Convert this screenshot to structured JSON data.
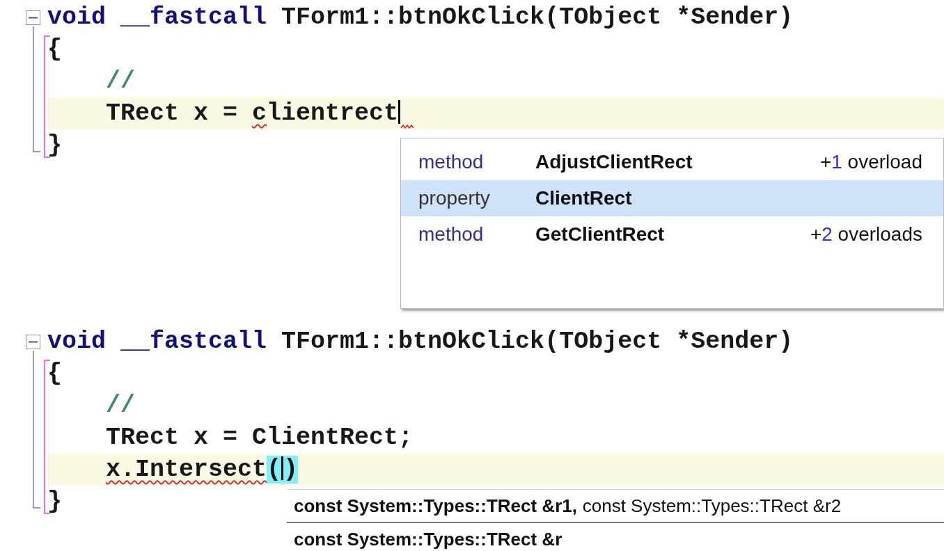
{
  "editors": [
    {
      "expanded": true,
      "lines": [
        {
          "current": false,
          "indented": false,
          "tokens": [
            {
              "text": "void __fastcall",
              "kind": "keyword"
            },
            {
              "text": " TForm1::btnOkClick(TObject *Sender)",
              "kind": "plain"
            }
          ]
        },
        {
          "current": false,
          "indented": false,
          "tokens": [
            {
              "text": "{",
              "kind": "plain"
            }
          ]
        },
        {
          "current": false,
          "indented": true,
          "tokens": [
            {
              "text": "//",
              "kind": "comment"
            }
          ]
        },
        {
          "current": true,
          "indented": true,
          "tokens": [
            {
              "text": "TRect x = ",
              "kind": "plain"
            },
            {
              "text": "c",
              "kind": "plain",
              "error": true
            },
            {
              "text": "lientrect",
              "kind": "plain",
              "caret": true,
              "error_after": true
            }
          ]
        },
        {
          "current": false,
          "indented": false,
          "tokens": [
            {
              "text": "}",
              "kind": "plain"
            }
          ]
        }
      ],
      "completion": {
        "items": [
          {
            "kind": "method",
            "label": "method",
            "name": "AdjustClientRect",
            "selected": false,
            "overloads": {
              "prefix": "+",
              "count": "1",
              "label": "overload"
            }
          },
          {
            "kind": "property",
            "label": "property",
            "name": "ClientRect",
            "selected": true
          },
          {
            "kind": "method",
            "label": "method",
            "name": "GetClientRect",
            "selected": false,
            "overloads": {
              "prefix": "+",
              "count": "2",
              "label": "overloads"
            }
          }
        ]
      }
    },
    {
      "expanded": true,
      "lines": [
        {
          "current": false,
          "indented": false,
          "tokens": [
            {
              "text": "void __fastcall",
              "kind": "keyword"
            },
            {
              "text": " TForm1::btnOkClick(TObject *Sender)",
              "kind": "plain"
            }
          ]
        },
        {
          "current": false,
          "indented": false,
          "tokens": [
            {
              "text": "{",
              "kind": "plain"
            }
          ]
        },
        {
          "current": false,
          "indented": true,
          "tokens": [
            {
              "text": "//",
              "kind": "comment"
            }
          ]
        },
        {
          "current": false,
          "indented": true,
          "tokens": [
            {
              "text": "TRect x = ClientRect;",
              "kind": "plain"
            }
          ]
        },
        {
          "current": true,
          "indented": true,
          "tokens": [
            {
              "text": "x.Intersect",
              "kind": "plain",
              "error": true
            },
            {
              "text": "(",
              "kind": "brace-match",
              "caret": true
            },
            {
              "text": ")",
              "kind": "brace-match"
            }
          ]
        },
        {
          "current": false,
          "indented": false,
          "tokens": [
            {
              "text": "}",
              "kind": "plain"
            }
          ]
        }
      ],
      "param_hint": {
        "rows": [
          {
            "params": [
              {
                "text": "const System::Types::TRect &r1,",
                "current": true
              },
              {
                "text": "const System::Types::TRect &r2",
                "current": false
              }
            ]
          },
          {
            "params": [
              {
                "text": "const System::Types::TRect &r",
                "current": true
              }
            ]
          }
        ]
      }
    }
  ]
}
